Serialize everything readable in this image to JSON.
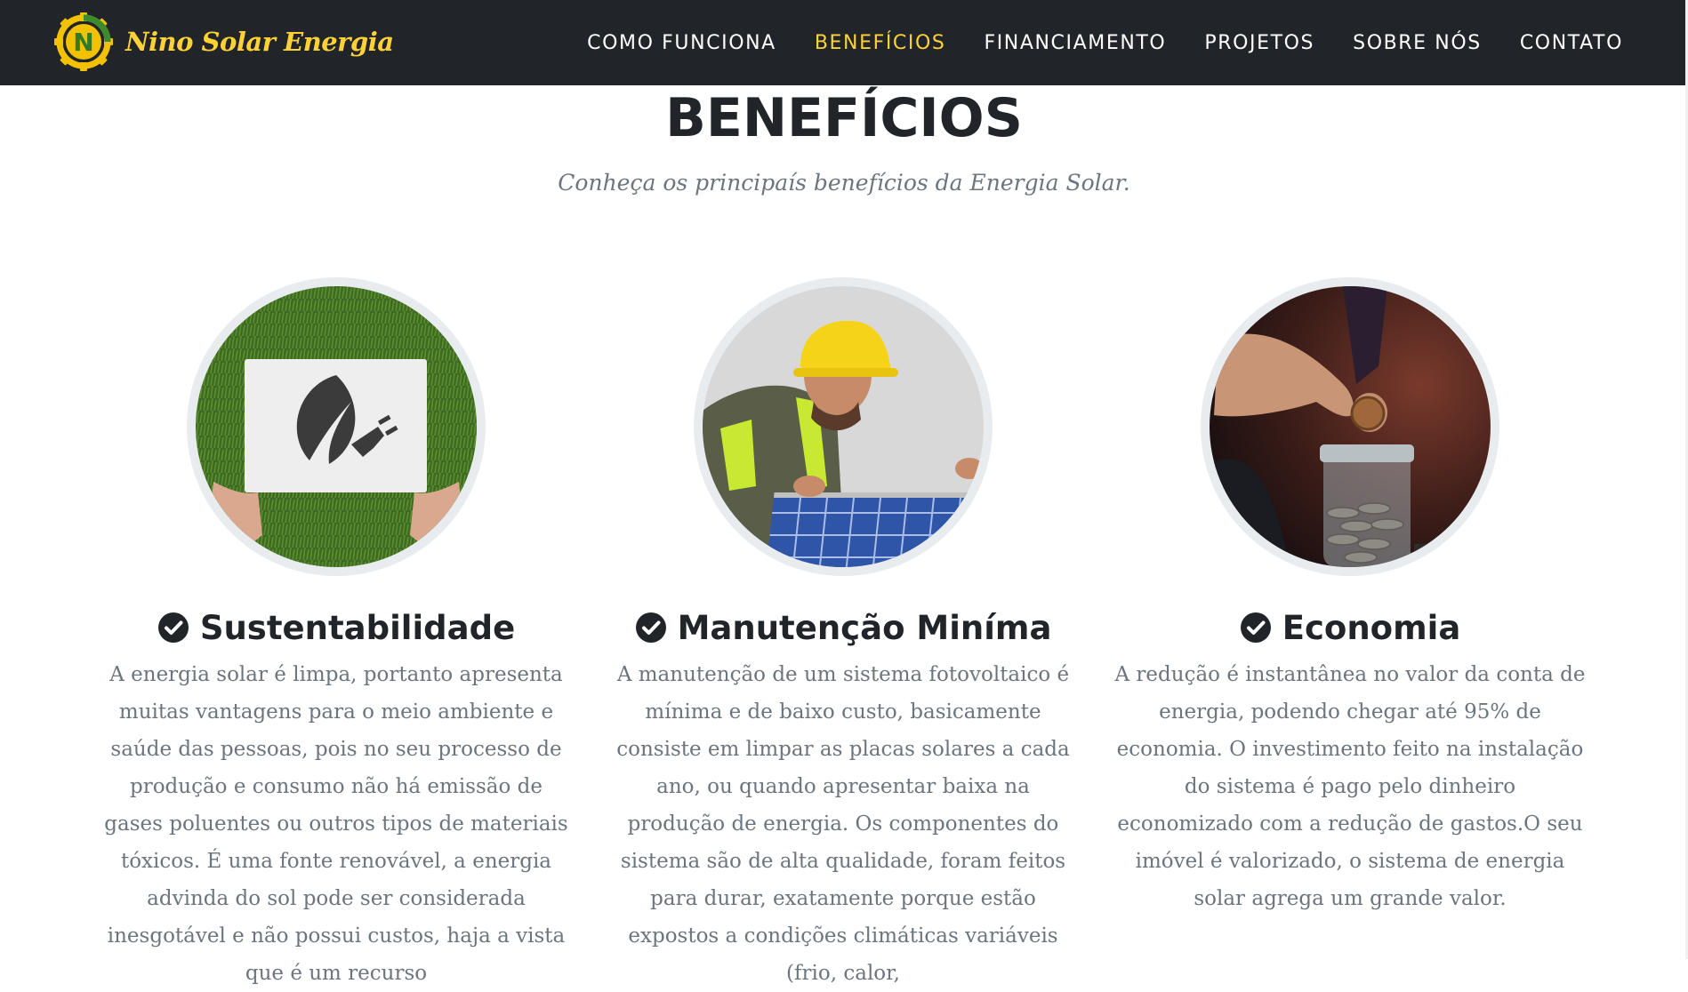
{
  "brand": {
    "name": "Nino Solar Energia",
    "logo_letter": "N"
  },
  "nav": {
    "items": [
      {
        "label": "Como Funciona",
        "active": false
      },
      {
        "label": "Benefícios",
        "active": true
      },
      {
        "label": "Financiamento",
        "active": false
      },
      {
        "label": "Projetos",
        "active": false
      },
      {
        "label": "Sobre Nós",
        "active": false
      },
      {
        "label": "Contato",
        "active": false
      }
    ]
  },
  "section": {
    "title": "BENEFÍCIOS",
    "subtitle": "Conheça os principaís benefícios da Energia Solar."
  },
  "features": [
    {
      "icon": "check-circle-icon",
      "image": "hands-holding-leaf-plug-sign",
      "title": "Sustentabilidade",
      "text": "A energia solar é limpa, portanto apresenta muitas vantagens para o meio ambiente e saúde das pessoas, pois no seu processo de produção e consumo não há emissão de gases poluentes ou outros tipos de materiais tóxicos. É uma fonte renovável, a energia advinda do sol pode ser considerada inesgotável e não possui custos, haja a vista que é um recurso"
    },
    {
      "icon": "check-circle-icon",
      "image": "technician-inspecting-solar-panel",
      "title": "Manutenção Miníma",
      "text": "A manutenção de um sistema fotovoltaico é mínima e de baixo custo, basicamente consiste em limpar as placas solares a cada ano, ou quando apresentar baixa na produção de energia. Os componentes do sistema são de alta qualidade, foram feitos para durar, exatamente porque estão expostos a condições climáticas variáveis (frio, calor,"
    },
    {
      "icon": "check-circle-icon",
      "image": "coin-dropped-in-savings-jar",
      "title": "Economia",
      "text": "A redução é instantânea no valor da conta de energia, podendo chegar até 95% de economia. O investimento feito na instalação do sistema é pago pelo dinheiro economizado com a redução de gastos.O seu imóvel é valorizado, o sistema de energia solar agrega um grande valor."
    }
  ],
  "colors": {
    "navbar": "#212529",
    "accent": "#fed136",
    "heading": "#212529",
    "body_text": "#6c757d"
  }
}
